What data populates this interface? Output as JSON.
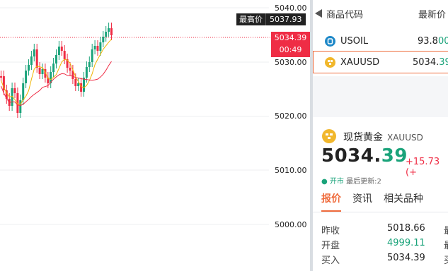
{
  "chart": {
    "axis_labels": [
      "5040.00",
      "5030.00",
      "5020.00",
      "5010.00",
      "5000.00"
    ],
    "high_tag_label": "最高价",
    "high_tag_value": "5037.93",
    "current_price": "5034.39",
    "countdown": "00:49",
    "colors": {
      "up": "#1aa37a",
      "down": "#ef2d45",
      "ma_short": "#f0b400",
      "ma_long": "#ef2d45"
    }
  },
  "watchlist": {
    "col_name": "商品代码",
    "col_price": "最新价",
    "items": [
      {
        "symbol": "USOIL",
        "price_main": "93.8",
        "price_tail": "00",
        "icon": "usoil-icon"
      },
      {
        "symbol": "XAUUSD",
        "price_main": "5034.",
        "price_tail": "39",
        "icon": "gold-icon",
        "selected": true
      }
    ]
  },
  "detail": {
    "name": "现货黄金",
    "symbol": "XAUUSD",
    "price_main": "5034.",
    "price_tail": "39",
    "change": "+15.73 (+",
    "status_open": "● 开市",
    "status_update": "最后更新:2",
    "tabs": [
      "报价",
      "资讯",
      "相关品种"
    ],
    "active_tab": "报价",
    "quotes": [
      {
        "label": "昨收",
        "value": "5018.66",
        "extra": "最"
      },
      {
        "label": "开盘",
        "value": "4999.11",
        "extra": "最"
      },
      {
        "label": "买入",
        "value": "5034.39",
        "extra": "买"
      }
    ]
  }
}
